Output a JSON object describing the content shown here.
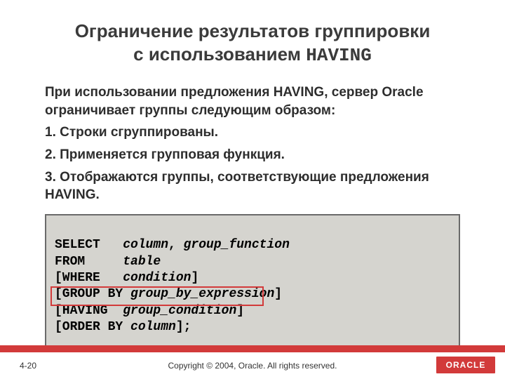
{
  "title_line1": "Ограничение результатов группировки",
  "title_line2_prefix": "с использованием ",
  "title_line2_keyword": "HAVING",
  "body": {
    "intro": "При использовании предложения HAVING, сервер Oracle ограничивает группы следующим образом:",
    "step1": "1. Строки сгруппированы.",
    "step2": "2. Применяется групповая функция.",
    "step3": "3. Отображаются группы, соответствующие предложения HAVING."
  },
  "code": {
    "l1_kw": "SELECT   ",
    "l1_it": "column",
    "l1_comma": ", ",
    "l1_it2": "group_function",
    "l2_kw": "FROM     ",
    "l2_it": "table",
    "l3_open": "[WHERE   ",
    "l3_it": "condition",
    "l3_close": "]",
    "l4_open": "[GROUP BY ",
    "l4_it": "group_by_expression",
    "l4_close": "]",
    "l5_open": "[HAVING  ",
    "l5_it": "group_condition",
    "l5_close": "]",
    "l6_open": "[ORDER BY ",
    "l6_it": "column",
    "l6_close": "];"
  },
  "footer": {
    "page": "4-20",
    "copyright": "Copyright © 2004, Oracle.  All rights reserved.",
    "logo": "ORACLE"
  }
}
